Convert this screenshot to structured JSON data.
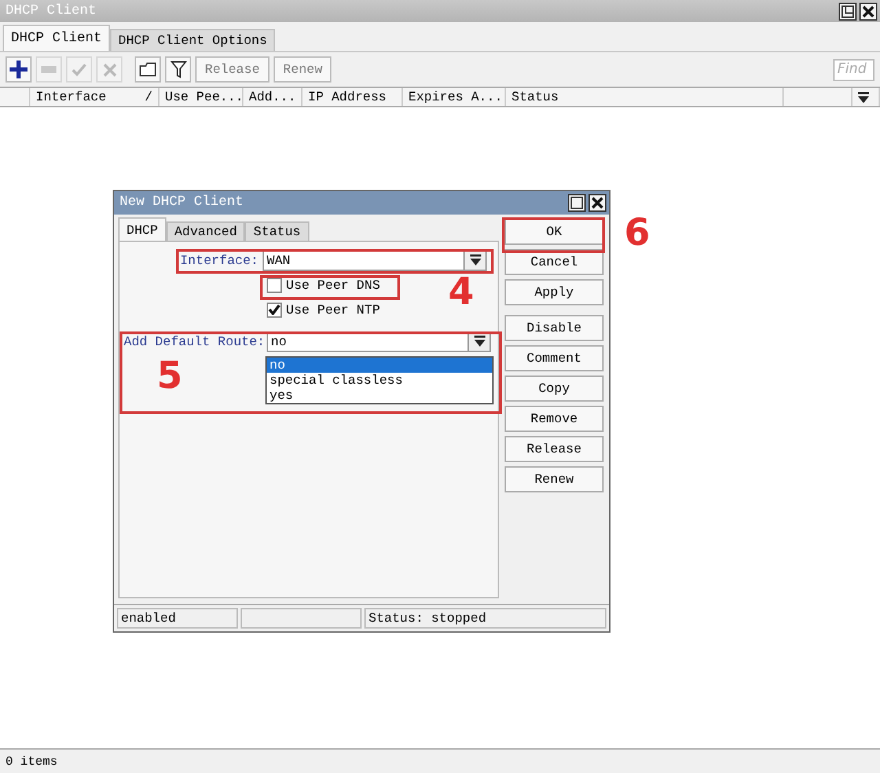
{
  "window": {
    "title": "DHCP Client"
  },
  "tabs": [
    {
      "label": "DHCP Client",
      "selected": true
    },
    {
      "label": "DHCP Client Options",
      "selected": false
    }
  ],
  "toolbar": {
    "icons": [
      {
        "kind": "add",
        "disabled": false
      },
      {
        "kind": "remove",
        "disabled": true
      },
      {
        "kind": "enable",
        "disabled": true
      },
      {
        "kind": "disable",
        "disabled": true
      },
      {
        "kind": "comment",
        "disabled": false
      },
      {
        "kind": "filter",
        "disabled": false
      }
    ],
    "buttons": [
      "Release",
      "Renew"
    ],
    "find": {
      "placeholder": "Find"
    }
  },
  "table": {
    "columns": [
      {
        "label": "Interface",
        "sort_mark": "/"
      },
      {
        "label": "Use Pee..."
      },
      {
        "label": "Add..."
      },
      {
        "label": "IP Address"
      },
      {
        "label": "Expires A..."
      },
      {
        "label": "Status"
      }
    ]
  },
  "status_bar": "0 items",
  "dialog": {
    "title": "New DHCP Client",
    "tabs": [
      {
        "label": "DHCP",
        "selected": true
      },
      {
        "label": "Advanced",
        "selected": false
      },
      {
        "label": "Status",
        "selected": false
      }
    ],
    "interface": {
      "label": "Interface:",
      "value": "WAN"
    },
    "checkboxes": [
      {
        "label": "Use Peer DNS",
        "checked": false
      },
      {
        "label": "Use Peer NTP",
        "checked": true
      }
    ],
    "default_route": {
      "label": "Add Default Route:",
      "value": "no",
      "options": [
        {
          "label": "no",
          "selected": true
        },
        {
          "label": "special classless",
          "selected": false
        },
        {
          "label": "yes",
          "selected": false
        }
      ]
    },
    "buttons": [
      "OK",
      "Cancel",
      "Apply",
      "Disable",
      "Comment",
      "Copy",
      "Remove",
      "Release",
      "Renew"
    ],
    "status": [
      "enabled",
      "Status: stopped"
    ]
  },
  "annotations": [
    {
      "label": "4"
    },
    {
      "label": "5"
    },
    {
      "label": "6"
    }
  ]
}
